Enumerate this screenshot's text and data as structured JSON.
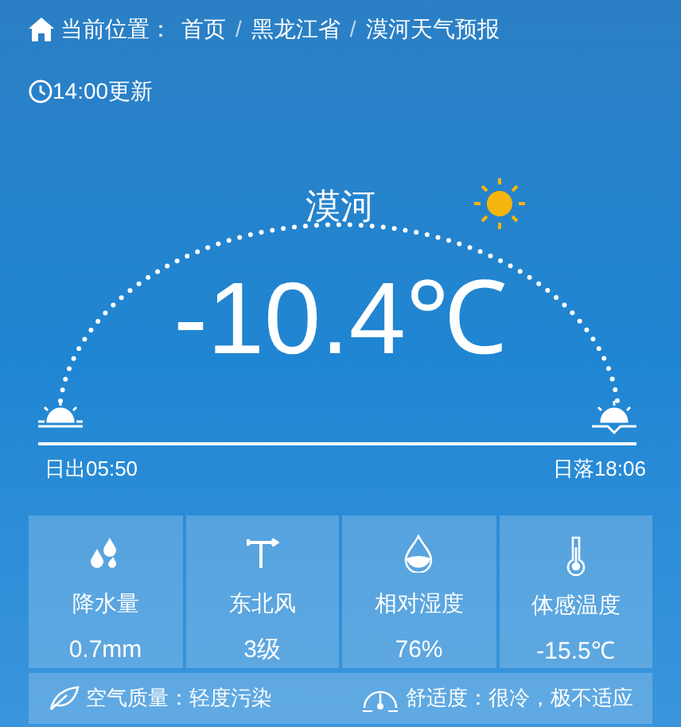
{
  "breadcrumb": {
    "prefix": "当前位置：",
    "items": [
      {
        "label": "首页"
      },
      {
        "label": "黑龙江省"
      },
      {
        "label": "漠河天气预报"
      }
    ],
    "separator": "/"
  },
  "update_time": "14:00更新",
  "city": "漠河",
  "temperature": "-10.4℃",
  "sunrise": "日出05:50",
  "sunset": "日落18:06",
  "stats": [
    {
      "kind": "rain",
      "label": "降水量",
      "value": "0.7mm"
    },
    {
      "kind": "wind",
      "label": "东北风",
      "value": "3级"
    },
    {
      "kind": "humidity",
      "label": "相对湿度",
      "value": "76%"
    },
    {
      "kind": "feels",
      "label": "体感温度",
      "value": "-15.5℃"
    }
  ],
  "air_quality": "空气质量：轻度污染",
  "comfort": "舒适度：很冷，极不适应"
}
